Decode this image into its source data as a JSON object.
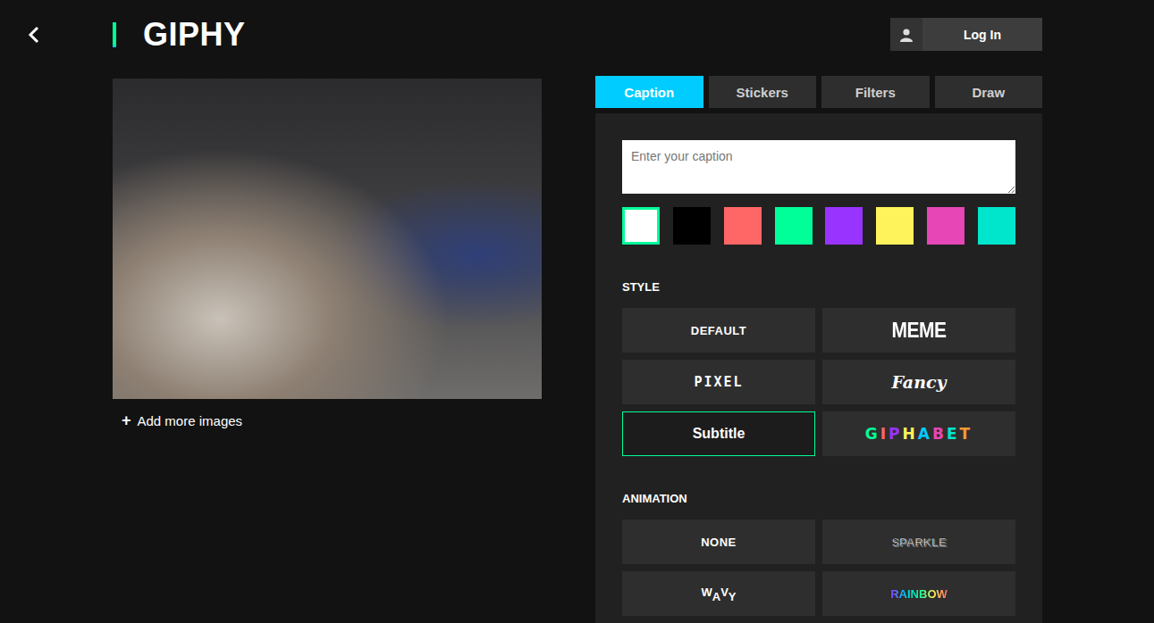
{
  "header": {
    "back_icon": "‹",
    "logo": "GIPHY",
    "login": "Log In"
  },
  "preview": {
    "add_icon": "+",
    "add_more": "Add more images"
  },
  "tabs": [
    {
      "label": "Caption",
      "selected": true
    },
    {
      "label": "Stickers",
      "selected": false
    },
    {
      "label": "Filters",
      "selected": false
    },
    {
      "label": "Draw",
      "selected": false
    }
  ],
  "caption": {
    "placeholder": "Enter your caption"
  },
  "colors": [
    {
      "color": "#ffffff",
      "selected": true
    },
    {
      "color": "#000000",
      "selected": false
    },
    {
      "color": "#ff6666",
      "selected": false
    },
    {
      "color": "#00ff99",
      "selected": false
    },
    {
      "color": "#9933ff",
      "selected": false
    },
    {
      "color": "#fff35c",
      "selected": false
    },
    {
      "color": "#e646b6",
      "selected": false
    },
    {
      "color": "#00e6cc",
      "selected": false
    }
  ],
  "style": {
    "title": "STYLE",
    "items": [
      {
        "label": "DEFAULT",
        "kind": "default",
        "selected": false
      },
      {
        "label": "MEME",
        "kind": "meme",
        "selected": false
      },
      {
        "label": "PIXEL",
        "kind": "pixel",
        "selected": false
      },
      {
        "label": "Fancy",
        "kind": "fancy",
        "selected": false
      },
      {
        "label": "Subtitle",
        "kind": "subtitle",
        "selected": true
      },
      {
        "label": "GIPHABET",
        "kind": "giphabet",
        "selected": false
      }
    ]
  },
  "animation": {
    "title": "ANIMATION",
    "items": [
      {
        "label": "NONE",
        "kind": "none",
        "selected": false
      },
      {
        "label": "SPARKLE",
        "kind": "sparkle",
        "selected": false
      },
      {
        "label": "WAVY",
        "kind": "wavy",
        "selected": false
      },
      {
        "label": "RAINBOW",
        "kind": "rainbow",
        "selected": false
      }
    ]
  }
}
